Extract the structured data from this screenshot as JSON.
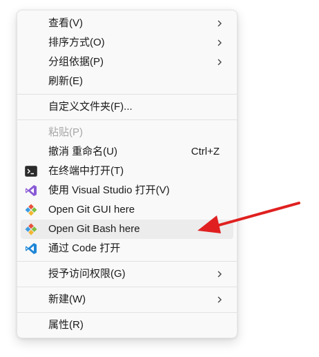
{
  "menu": {
    "items": [
      {
        "id": "view",
        "label": "查看(V)",
        "submenu": true
      },
      {
        "id": "sort",
        "label": "排序方式(O)",
        "submenu": true
      },
      {
        "id": "group",
        "label": "分组依据(P)",
        "submenu": true
      },
      {
        "id": "refresh",
        "label": "刷新(E)"
      },
      {
        "id": "customize",
        "label": "自定义文件夹(F)..."
      },
      {
        "id": "paste",
        "label": "粘贴(P)",
        "disabled": true
      },
      {
        "id": "undo",
        "label": "撤消 重命名(U)",
        "shortcut": "Ctrl+Z"
      },
      {
        "id": "terminal",
        "label": "在终端中打开(T)",
        "icon": "terminal-icon"
      },
      {
        "id": "vs",
        "label": "使用 Visual Studio 打开(V)",
        "icon": "visual-studio-icon"
      },
      {
        "id": "git-gui",
        "label": "Open Git GUI here",
        "icon": "git-icon"
      },
      {
        "id": "git-bash",
        "label": "Open Git Bash here",
        "icon": "git-icon",
        "highlighted": true
      },
      {
        "id": "vscode",
        "label": "通过 Code 打开",
        "icon": "vscode-icon"
      },
      {
        "id": "grant",
        "label": "授予访问权限(G)",
        "submenu": true
      },
      {
        "id": "new",
        "label": "新建(W)",
        "submenu": true
      },
      {
        "id": "properties",
        "label": "属性(R)"
      }
    ]
  },
  "colors": {
    "annotation_arrow": "#e02020",
    "vs_purple": "#8a5bd6",
    "vscode_blue": "#1f86d6",
    "terminal_bg": "#2b2b2b"
  }
}
